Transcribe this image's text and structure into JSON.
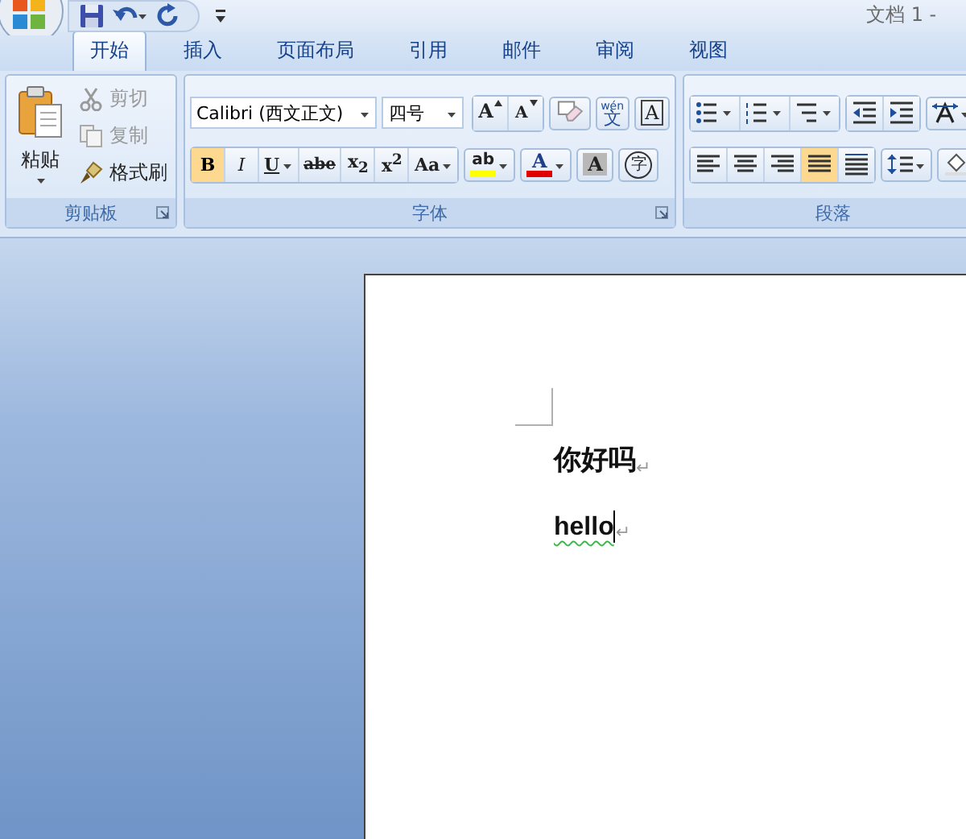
{
  "window": {
    "title": "文档 1 -"
  },
  "tabs": [
    {
      "label": "开始",
      "selected": true
    },
    {
      "label": "插入",
      "selected": false
    },
    {
      "label": "页面布局",
      "selected": false
    },
    {
      "label": "引用",
      "selected": false
    },
    {
      "label": "邮件",
      "selected": false
    },
    {
      "label": "审阅",
      "selected": false
    },
    {
      "label": "视图",
      "selected": false
    }
  ],
  "clipboard": {
    "title": "剪贴板",
    "paste": "粘贴",
    "items": [
      {
        "kind": "cut",
        "label": "剪切",
        "disabled": true
      },
      {
        "kind": "copy",
        "label": "复制",
        "disabled": true
      },
      {
        "kind": "brush",
        "label": "格式刷",
        "disabled": false
      }
    ]
  },
  "font": {
    "title": "字体",
    "font_name": "Calibri (西文正文)",
    "font_size": "四号",
    "row_1": [
      {
        "kind": "grow",
        "label": "A"
      },
      {
        "kind": "shrink",
        "label": "A"
      },
      {
        "kind": "clear"
      },
      {
        "kind": "phonetic",
        "label": "文",
        "ruby": "wén"
      },
      {
        "kind": "border",
        "label": "A"
      }
    ],
    "row_2": [
      {
        "kind": "bold",
        "label": "B",
        "on": true
      },
      {
        "kind": "italic",
        "label": "I",
        "on": false
      },
      {
        "kind": "underline",
        "label": "U",
        "on": false
      },
      {
        "kind": "strike",
        "label": "abe",
        "on": false
      },
      {
        "kind": "sub",
        "label": "x$_{2}$",
        "on": false
      },
      {
        "kind": "sup",
        "label": "x$^{2}$",
        "on": false
      },
      {
        "kind": "case",
        "label": "Aa",
        "on": false
      }
    ],
    "colors": [
      {
        "kind": "highlight",
        "label": "ab",
        "color": "#ffff00"
      },
      {
        "kind": "fontcolor",
        "label": "A",
        "color": "#e00000"
      }
    ],
    "extras": [
      {
        "kind": "shade",
        "label": "A"
      },
      {
        "kind": "enclose",
        "label": "字"
      }
    ]
  },
  "paragraph": {
    "title": "段落",
    "alignment": [
      {
        "kind": "left",
        "selected": false
      },
      {
        "kind": "center",
        "selected": false
      },
      {
        "kind": "right",
        "selected": false
      },
      {
        "kind": "justify",
        "selected": true
      },
      {
        "kind": "distributed",
        "selected": false
      }
    ]
  },
  "document": {
    "paragraphs": [
      {
        "kind": "chinese",
        "text": "你好吗",
        "mark": "↵"
      },
      {
        "kind": "latin",
        "text": "hello",
        "mark": "↵",
        "spelling_error": true,
        "cursor": true
      }
    ]
  }
}
